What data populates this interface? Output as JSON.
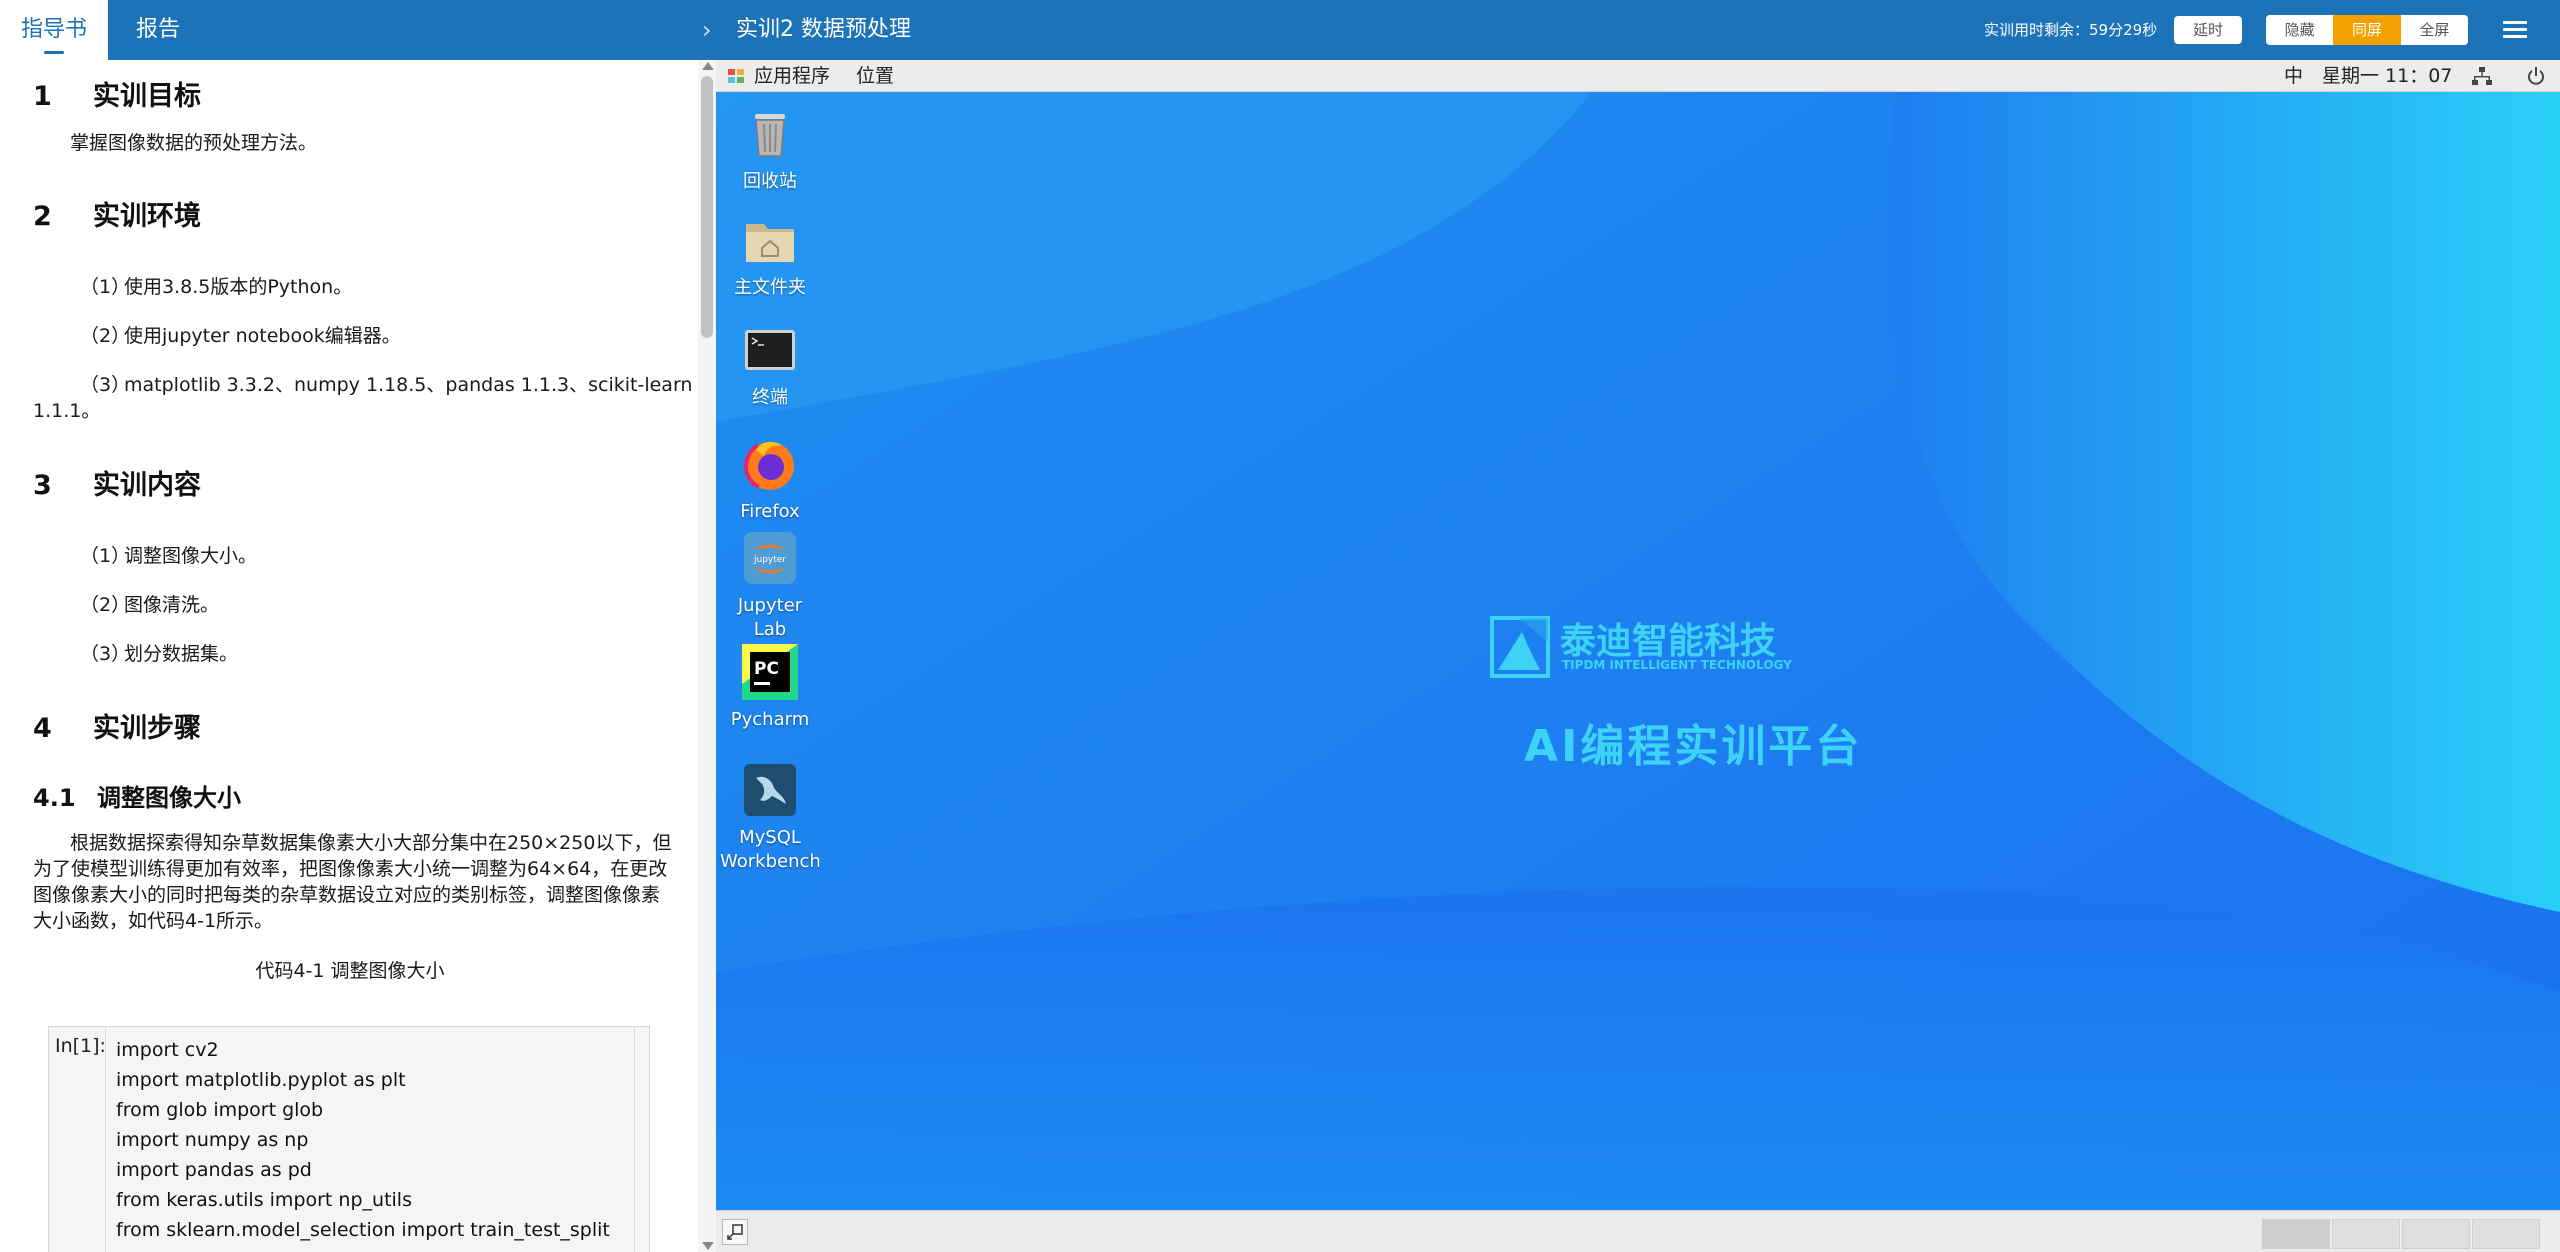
{
  "topbar": {
    "tabs": [
      "指导书",
      "报告"
    ],
    "title": "实训2 数据预处理",
    "timer": "实训用时剩余：59分29秒",
    "delay_label": "延时",
    "view_modes": [
      "隐藏",
      "同屏",
      "全屏"
    ],
    "active_view_mode": "同屏"
  },
  "guide": {
    "s1": {
      "num": "1",
      "title": "实训目标",
      "text": "掌握图像数据的预处理方法。"
    },
    "s2": {
      "num": "2",
      "title": "实训环境",
      "items": [
        {
          "idx": "（1）",
          "text": "使用3.8.5版本的Python。"
        },
        {
          "idx": "（2）",
          "text": "使用jupyter notebook编辑器。"
        },
        {
          "idx": "（3）",
          "text": "matplotlib 3.3.2、numpy 1.18.5、pandas 1.1.3、scikit-learn",
          "cont": "1.1.1。"
        }
      ]
    },
    "s3": {
      "num": "3",
      "title": "实训内容",
      "items": [
        {
          "idx": "（1）",
          "text": "调整图像大小。"
        },
        {
          "idx": "（2）",
          "text": "图像清洗。"
        },
        {
          "idx": "（3）",
          "text": "划分数据集。"
        }
      ]
    },
    "s4": {
      "num": "4",
      "title": "实训步骤"
    },
    "s41": {
      "num": "4.1",
      "title": "调整图像大小",
      "lines": [
        "根据数据探索得知杂草数据集像素大小大部分集中在250×250以下，但",
        "为了使模型训练得更加有效率，把图像像素大小统一调整为64×64，在更改",
        "图像像素大小的同时把每类的杂草数据设立对应的类别标签，调整图像像素",
        "大小函数，如代码4-1所示。"
      ],
      "caption": "代码4-1 调整图像大小"
    },
    "code": {
      "prompt": "In[1]:",
      "lines": [
        "import cv2",
        "import matplotlib.pyplot as plt",
        "from glob import glob",
        "import numpy as np",
        "import pandas as pd",
        "from keras.utils import np_utils",
        "from sklearn.model_selection import train_test_split"
      ]
    }
  },
  "desktop": {
    "panel": {
      "apps": "应用程序",
      "places": "位置",
      "ime": "中",
      "clock": "星期一 11：07"
    },
    "icons": [
      {
        "label": "回收站",
        "icon": "trash-icon"
      },
      {
        "label": "主文件夹",
        "icon": "home-folder-icon"
      },
      {
        "label": "终端",
        "icon": "terminal-icon"
      },
      {
        "label": "Firefox",
        "icon": "firefox-icon"
      },
      {
        "label": "Jupyter Lab",
        "icon": "jupyter-icon"
      },
      {
        "label": "Pycharm",
        "icon": "pycharm-icon"
      },
      {
        "label": "MySQL Workbench",
        "icon": "mysql-workbench-icon"
      }
    ],
    "brand": {
      "name": "泰迪智能科技",
      "sub": "TIPDM INTELLIGENT TECHNOLOGY",
      "slogan": "AI编程实训平台"
    },
    "colors": {
      "bg_start": "#1a6ff0",
      "bg_end": "#2ad0f8",
      "brand": "#3dd3f6",
      "accent": "#f5a000",
      "topbar": "#1d73b7"
    }
  }
}
